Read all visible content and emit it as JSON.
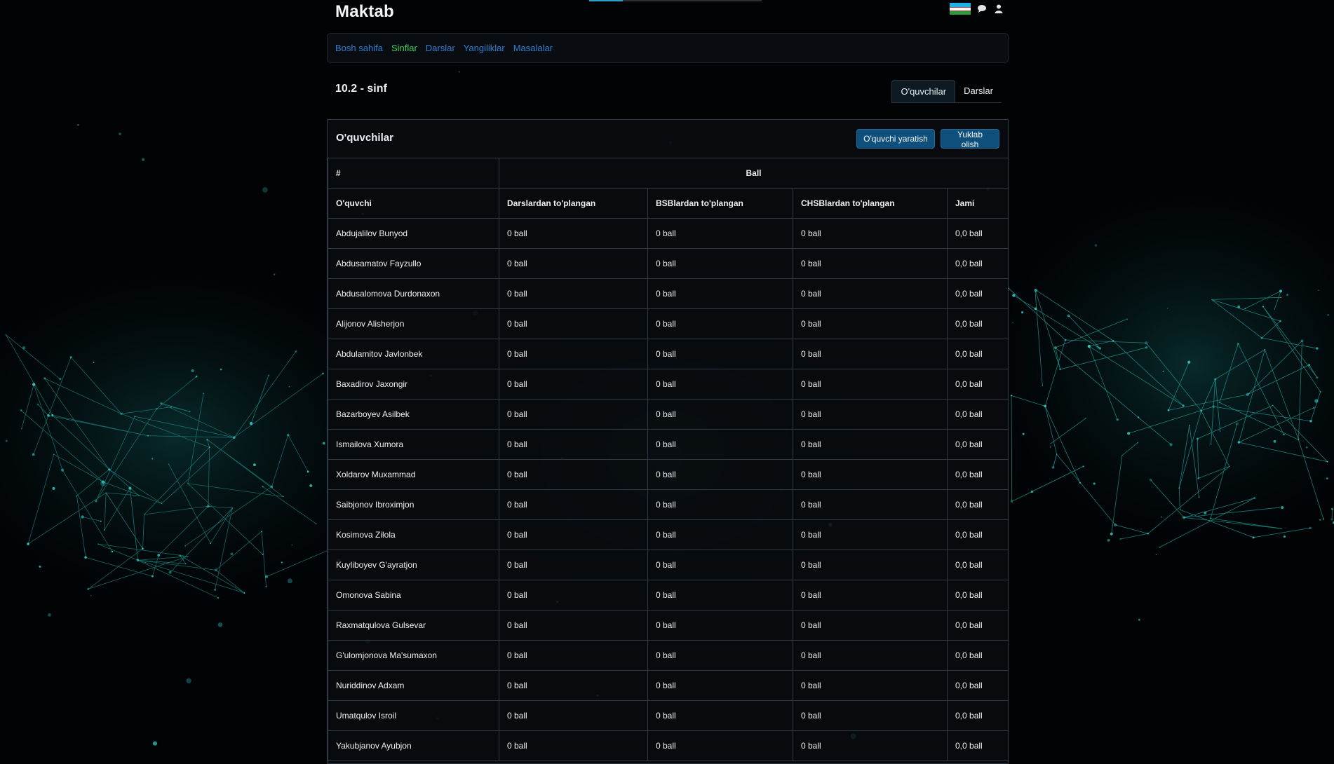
{
  "app": {
    "brand": "Maktab"
  },
  "header": {
    "flag_colors": [
      "#1eb3e7",
      "#ffffff",
      "#2e9a3b"
    ],
    "icons": [
      "chat-icon",
      "user-icon"
    ]
  },
  "nav": {
    "items": [
      {
        "label": "Bosh sahifa",
        "active": false
      },
      {
        "label": "Sinflar",
        "active": true
      },
      {
        "label": "Darslar",
        "active": false
      },
      {
        "label": "Yangiliklar",
        "active": false
      },
      {
        "label": "Masalalar",
        "active": false
      }
    ],
    "link_color": "#2f7fd1",
    "active_color": "#3dcc5b"
  },
  "page": {
    "title": "10.2 - sinf"
  },
  "tabs": [
    {
      "label": "O'quvchilar",
      "active": true
    },
    {
      "label": "Darslar",
      "active": false
    }
  ],
  "card": {
    "title": "O'quvchilar",
    "create_label": "O'quvchi yaratish",
    "download_label": "Yuklab olish"
  },
  "table": {
    "hash_label": "#",
    "group_label": "Ball",
    "columns": [
      "O'quvchi",
      "Darslardan to'plangan",
      "BSBlardan to'plangan",
      "CHSBlardan to'plangan",
      "Jami"
    ],
    "rows": [
      [
        "Abdujalilov Bunyod",
        "0 ball",
        "0 ball",
        "0 ball",
        "0,0 ball"
      ],
      [
        "Abdusamatov Fayzullo",
        "0 ball",
        "0 ball",
        "0 ball",
        "0,0 ball"
      ],
      [
        "Abdusalomova Durdonaxon",
        "0 ball",
        "0 ball",
        "0 ball",
        "0,0 ball"
      ],
      [
        "Alijonov Alisherjon",
        "0 ball",
        "0 ball",
        "0 ball",
        "0,0 ball"
      ],
      [
        "Abdulamitov Javlonbek",
        "0 ball",
        "0 ball",
        "0 ball",
        "0,0 ball"
      ],
      [
        "Baxadirov Jaxongir",
        "0 ball",
        "0 ball",
        "0 ball",
        "0,0 ball"
      ],
      [
        "Bazarboyev Asilbek",
        "0 ball",
        "0 ball",
        "0 ball",
        "0,0 ball"
      ],
      [
        "Ismailova Xumora",
        "0 ball",
        "0 ball",
        "0 ball",
        "0,0 ball"
      ],
      [
        "Xoldarov Muxammad",
        "0 ball",
        "0 ball",
        "0 ball",
        "0,0 ball"
      ],
      [
        "Saibjonov Ibroximjon",
        "0 ball",
        "0 ball",
        "0 ball",
        "0,0 ball"
      ],
      [
        "Kosimova Zilola",
        "0 ball",
        "0 ball",
        "0 ball",
        "0,0 ball"
      ],
      [
        "Kuyliboyev G'ayratjon",
        "0 ball",
        "0 ball",
        "0 ball",
        "0,0 ball"
      ],
      [
        "Omonova Sabina",
        "0 ball",
        "0 ball",
        "0 ball",
        "0,0 ball"
      ],
      [
        "Raxmatqulova Gulsevar",
        "0 ball",
        "0 ball",
        "0 ball",
        "0,0 ball"
      ],
      [
        "G'ulomjonova Ma'sumaxon",
        "0 ball",
        "0 ball",
        "0 ball",
        "0,0 ball"
      ],
      [
        "Nuriddinov Adxam",
        "0 ball",
        "0 ball",
        "0 ball",
        "0,0 ball"
      ],
      [
        "Umatqulov Isroil",
        "0 ball",
        "0 ball",
        "0 ball",
        "0,0 ball"
      ],
      [
        "Yakubjanov Ayubjon",
        "0 ball",
        "0 ball",
        "0 ball",
        "0,0 ball"
      ]
    ]
  }
}
